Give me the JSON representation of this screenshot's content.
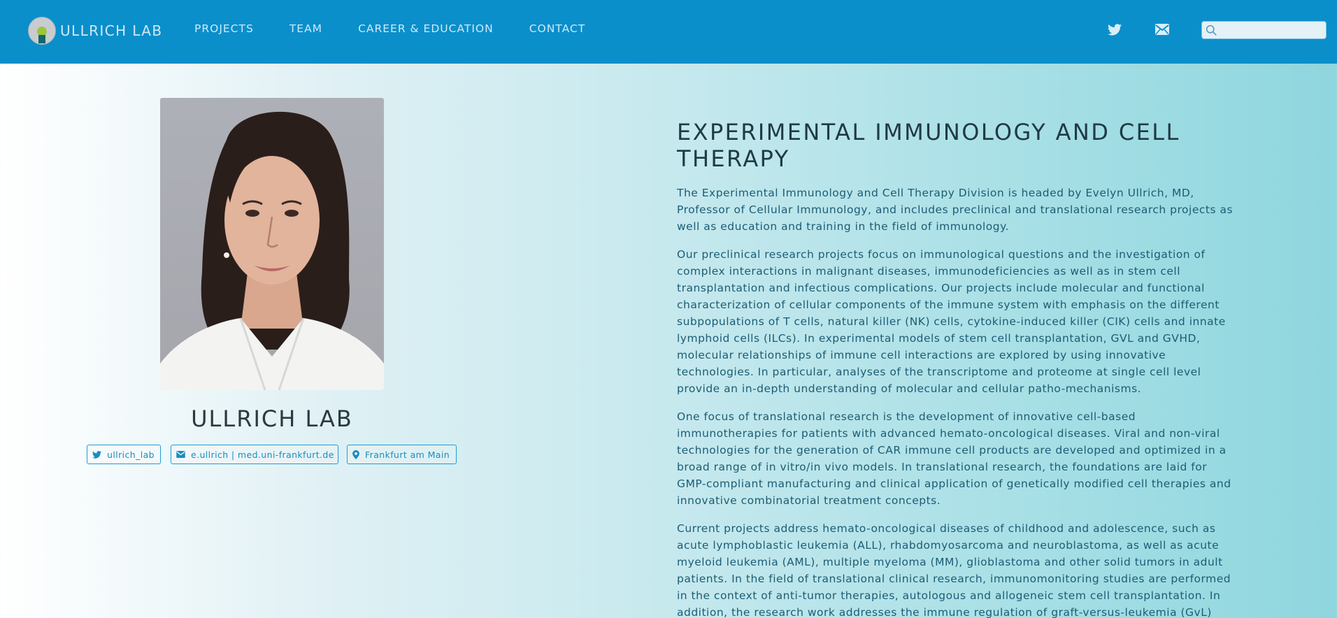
{
  "header": {
    "logo_text": "ULLRICH LAB",
    "nav": [
      {
        "label": "PROJECTS"
      },
      {
        "label": "TEAM"
      },
      {
        "label": "CAREER & EDUCATION"
      },
      {
        "label": "CONTACT"
      }
    ],
    "social_icons": [
      "twitter-icon",
      "mail-icon"
    ],
    "search": {
      "placeholder": "",
      "value": ""
    }
  },
  "profile": {
    "title": "ULLRICH LAB",
    "chips": [
      {
        "icon": "twitter-icon",
        "label": "ullrich_lab"
      },
      {
        "icon": "mail-icon",
        "label": "e.ullrich | med.uni-frankfurt.de"
      },
      {
        "icon": "location-pin-icon",
        "label": "Frankfurt am Main"
      }
    ]
  },
  "main": {
    "heading": "EXPERIMENTAL IMMUNOLOGY AND CELL THERAPY",
    "paragraphs": [
      "The Experimental Immunology and Cell Therapy Division is headed by Evelyn Ullrich, MD, Professor of Cellular Immunology, and includes preclinical and translational research projects as well as education and training in the field of immunology.",
      "Our preclinical research projects focus on immunological questions and the investigation of complex interactions in malignant diseases, immunodeficiencies as well as in stem cell transplantation and infectious complications. Our projects include molecular and functional characterization of cellular components of the immune system with emphasis on the different subpopulations of T cells, natural killer (NK) cells, cytokine-induced killer (CIK) cells and innate lymphoid cells (ILCs). In experimental models of stem cell transplantation, GVL and GVHD, molecular relationships of immune cell interactions are explored by using innovative technologies. In particular, analyses of the transcriptome and proteome at single cell level provide an in-depth understanding of molecular and cellular patho-mechanisms.",
      "One focus of translational research is the development of innovative cell-based immunotherapies for patients with advanced hemato-oncological diseases. Viral and non-viral technologies for the generation of CAR immune cell products are developed and optimized in a broad range of in vitro/in vivo models. In translational research, the foundations are laid for GMP-compliant manufacturing and clinical application of genetically modified cell therapies and innovative combinatorial treatment concepts.",
      "Current projects address hemato-oncological diseases of childhood and adolescence, such as acute lymphoblastic leukemia (ALL), rhabdomyosarcoma and neuroblastoma, as well as acute myeloid leukemia (AML), multiple myeloma (MM), glioblastoma and other solid tumors in adult patients. In the field of translational clinical research, immunomonitoring studies are performed in the context of anti-tumor therapies, autologous and allogeneic stem cell transplantation. In addition, the research work addresses the immune regulation of graft-versus-leukemia (GvL) and"
    ]
  },
  "colors": {
    "header_bg": "#0a8fcb",
    "nav_text": "#cfe9f6",
    "accent": "#1a9fd0",
    "heading_text": "#1f3a44",
    "body_text": "#1d5c74"
  }
}
